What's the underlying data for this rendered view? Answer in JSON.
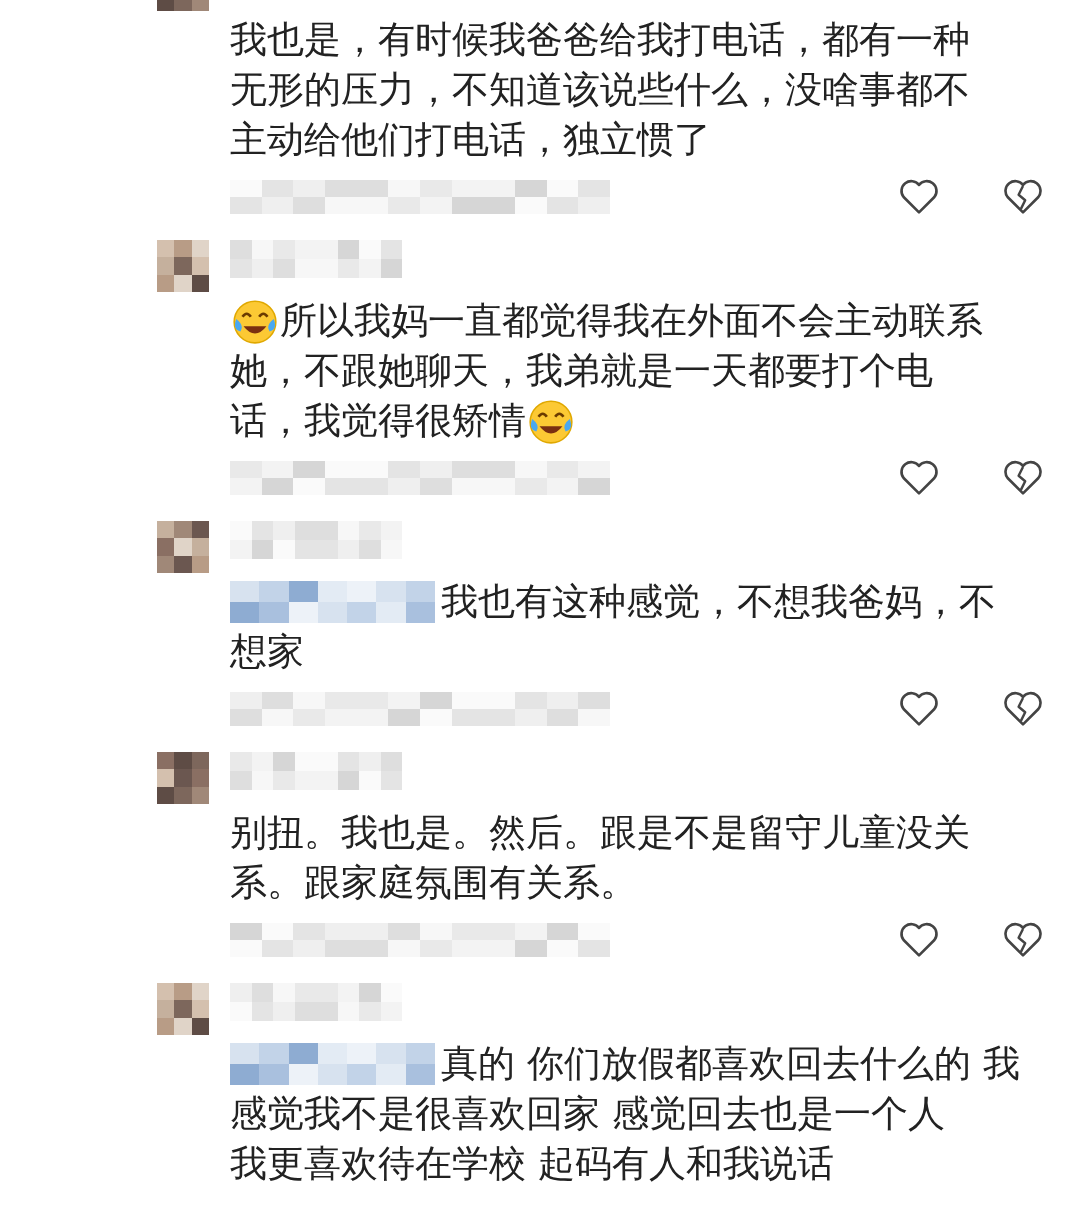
{
  "comments": [
    {
      "mention_hidden": false,
      "lines": [
        [
          {
            "kind": "text",
            "text": "我也是，有时候我爸爸给我打电话，都有一种"
          }
        ],
        [
          {
            "kind": "text",
            "text": "无形的压力，不知道该说些什么，没啥事都不"
          }
        ],
        [
          {
            "kind": "text",
            "text": "主动给他们打电话，独立惯了"
          }
        ]
      ]
    },
    {
      "mention_hidden": false,
      "lines": [
        [
          {
            "kind": "emoji"
          },
          {
            "kind": "text",
            "text": "所以我妈一直都觉得我在外面不会主动联系"
          }
        ],
        [
          {
            "kind": "text",
            "text": "她，不跟她聊天，我弟就是一天都要打个电"
          }
        ],
        [
          {
            "kind": "text",
            "text": "话，我觉得很矫情"
          },
          {
            "kind": "emoji"
          }
        ]
      ]
    },
    {
      "mention_hidden": true,
      "lines": [
        [
          {
            "kind": "text",
            "text": "我也有这种感觉，不想我爸妈，不"
          }
        ],
        [
          {
            "kind": "text",
            "text": "想家"
          }
        ]
      ]
    },
    {
      "mention_hidden": false,
      "lines": [
        [
          {
            "kind": "text",
            "text": "别扭。我也是。然后。跟是不是留守儿童没关"
          }
        ],
        [
          {
            "kind": "text",
            "text": "系。跟家庭氛围有关系。"
          }
        ]
      ]
    },
    {
      "mention_hidden": true,
      "lines": [
        [
          {
            "kind": "text",
            "text": "真的 你们放假都喜欢回去什么的 我"
          }
        ],
        [
          {
            "kind": "text",
            "text": "感觉我不是很喜欢回家 感觉回去也是一个人"
          }
        ],
        [
          {
            "kind": "text",
            "text": "我更喜欢待在学校 起码有人和我说话"
          }
        ]
      ]
    }
  ]
}
